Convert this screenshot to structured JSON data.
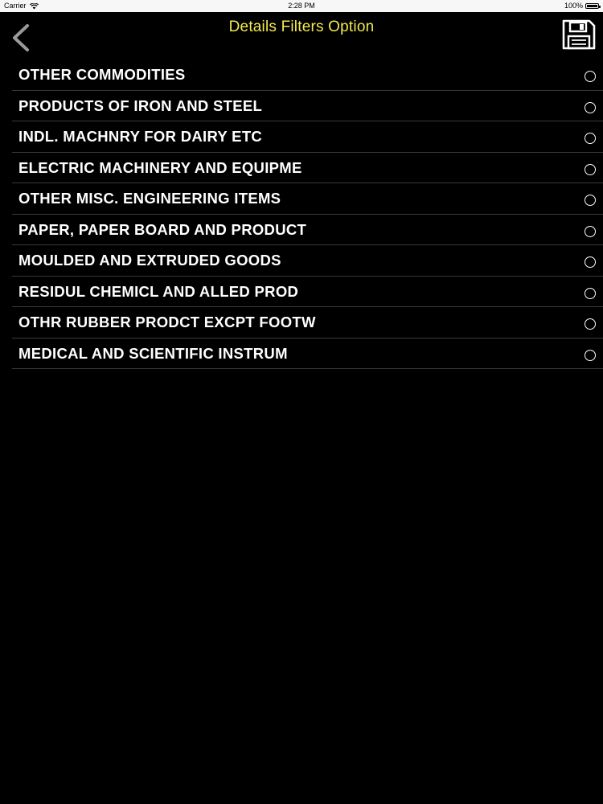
{
  "status_bar": {
    "carrier": "Carrier",
    "time": "2:28 PM",
    "battery": "100%"
  },
  "nav": {
    "title": "Details Filters Option",
    "back_icon": "chevron-left-icon",
    "save_icon": "floppy-disk-icon"
  },
  "colors": {
    "background": "#000000",
    "title": "#f2e94e",
    "item_text": "#ffffff",
    "separator": "#3a3a3a"
  },
  "items": [
    {
      "label": "OTHER COMMODITIES",
      "selected": false
    },
    {
      "label": "PRODUCTS OF IRON AND STEEL",
      "selected": false
    },
    {
      "label": "INDL. MACHNRY FOR DAIRY ETC",
      "selected": false
    },
    {
      "label": "ELECTRIC MACHINERY AND EQUIPME",
      "selected": false
    },
    {
      "label": "OTHER MISC. ENGINEERING ITEMS",
      "selected": false
    },
    {
      "label": "PAPER, PAPER BOARD AND PRODUCT",
      "selected": false
    },
    {
      "label": "MOULDED AND EXTRUDED GOODS",
      "selected": false
    },
    {
      "label": "RESIDUL CHEMICL AND ALLED PROD",
      "selected": false
    },
    {
      "label": "OTHR RUBBER PRODCT EXCPT FOOTW",
      "selected": false
    },
    {
      "label": "MEDICAL AND SCIENTIFIC INSTRUM",
      "selected": false
    }
  ]
}
